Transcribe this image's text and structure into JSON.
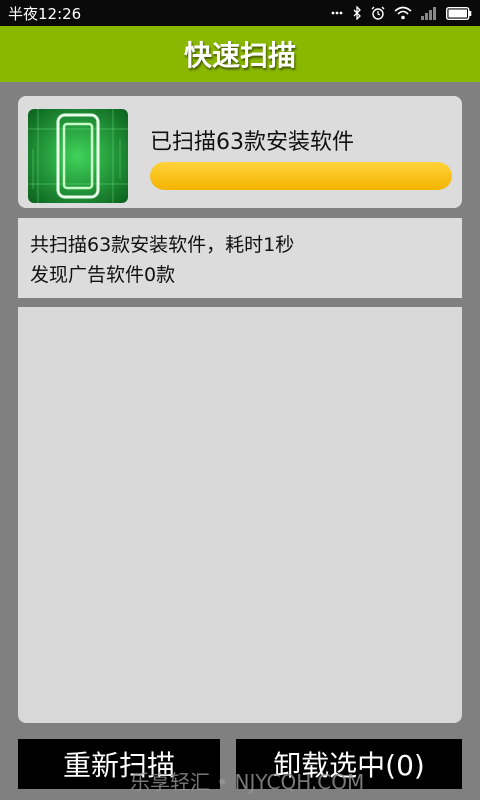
{
  "status_bar": {
    "time": "半夜12:26",
    "icons": [
      "dots-icon",
      "bluetooth-icon",
      "alarm-icon",
      "wifi-icon",
      "signal-icon",
      "battery-icon"
    ]
  },
  "app_bar": {
    "title": "快速扫描"
  },
  "scan_panel": {
    "status_text": "已扫描63款安装软件",
    "progress_percent": 100,
    "progress_color": "#f5b400",
    "thumbnail_icon": "phone-scan-icon"
  },
  "result_panel": {
    "line1": "共扫描63款安装软件，耗时1秒",
    "line2": "发现广告软件0款"
  },
  "buttons": {
    "rescan": "重新扫描",
    "uninstall_selected": "卸载选中(0)"
  },
  "watermark": "乐享轻汇 • NJYCQH.COM",
  "colors": {
    "app_bar": "#8ab800",
    "background": "#808080"
  }
}
